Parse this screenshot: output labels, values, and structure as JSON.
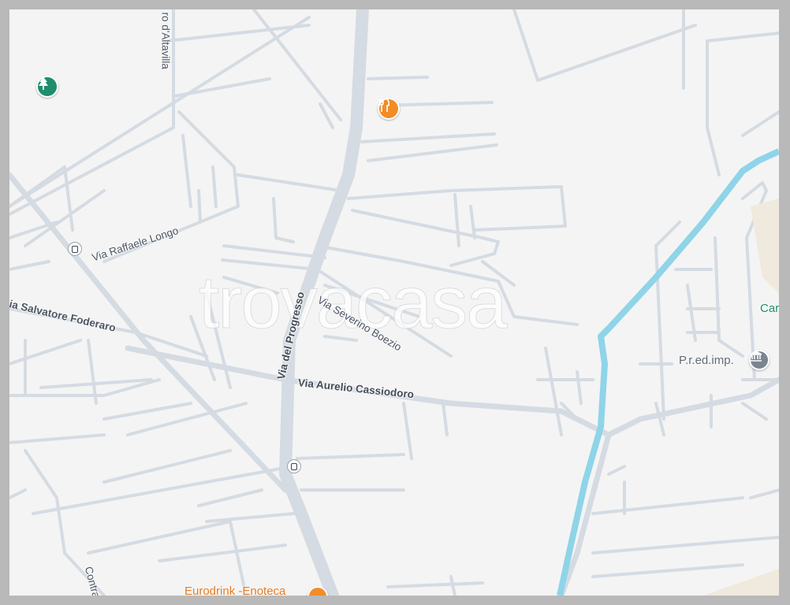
{
  "map": {
    "background_color": "#f4f4f4",
    "road_color": "#d5dbe2",
    "water_color": "#8fd4e8",
    "watermark": "trovacasa"
  },
  "streets": {
    "altavilla": "ro d'Altavilla",
    "raffaele_longo": "Via Raffaele Longo",
    "salvatore_foderaro": "ia Salvatore Foderaro",
    "progresso": "Via del Progresso",
    "severino_boezio": "Via Severino Boezio",
    "aurelio_cassiodoro": "Via Aurelio Cassiodoro",
    "contra": "Contra"
  },
  "pois": {
    "pred_imp": {
      "label": "P.r.ed.imp.",
      "icon": "institution-icon",
      "color": "#5f6b76"
    },
    "car_partial": {
      "label": "Car",
      "color": "#1e8e6e"
    },
    "eurodrink": {
      "label": "Eurodrink -Enoteca",
      "icon": "shopping-icon",
      "color": "#e37b23"
    },
    "restaurant": {
      "icon": "restaurant-icon",
      "color": "#f28c28"
    },
    "park": {
      "icon": "tree-icon",
      "color": "#1e8e6e"
    },
    "bus_stops": [
      "bus-stop-icon",
      "bus-stop-icon"
    ]
  }
}
